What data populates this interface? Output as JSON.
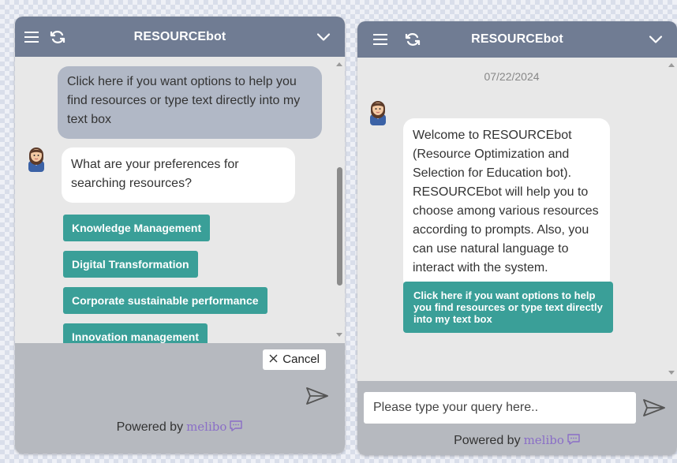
{
  "left_window": {
    "title": "RESOURCEbot",
    "user_message": "Click here if you want options to help you find resources or type text directly into my text box",
    "bot_message": "What are your preferences for searching resources?",
    "options": [
      "Knowledge Management",
      "Digital Transformation",
      "Corporate sustainable performance",
      "Innovation management"
    ],
    "cancel_label": "Cancel",
    "powered_by": "Powered by",
    "brand": "melibo"
  },
  "right_window": {
    "title": "RESOURCEbot",
    "date": "07/22/2024",
    "bot_message": "Welcome to RESOURCEbot (Resource Optimization and Selection for Education bot). RESOURCEbot will help you to choose among various resources according to prompts. Also, you can use natural language to interact with the system.",
    "cta_button": "Click here if you want options to help you find resources or type text directly into my text box",
    "input_placeholder": "Please type your query here..",
    "powered_by": "Powered by",
    "brand": "melibo"
  },
  "icons": {
    "menu": "hamburger-menu-icon",
    "refresh": "refresh-icon",
    "collapse": "chevron-down-icon",
    "send": "send-icon",
    "avatar": "bot-avatar-icon",
    "brand_logo": "speech-bubble-icon"
  },
  "colors": {
    "header": "#707c93",
    "option_button": "#3a9f98",
    "user_bubble": "#b1b8c6",
    "footer": "#b6b9bf",
    "brand": "#8a6ec7"
  }
}
